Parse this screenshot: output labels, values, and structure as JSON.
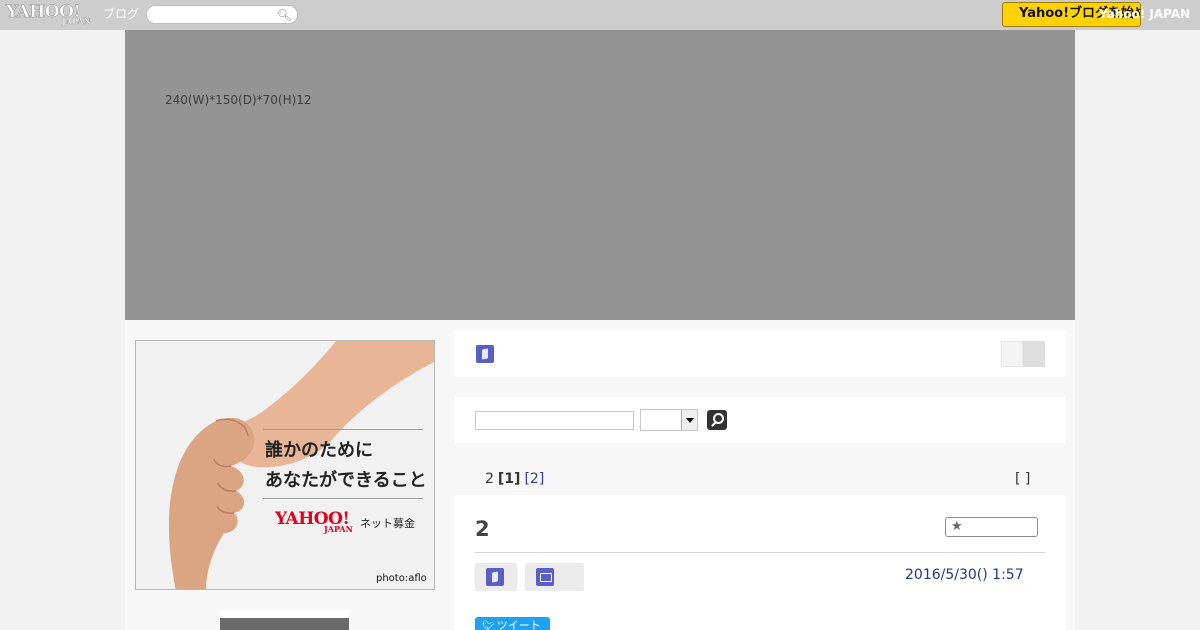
{
  "topbar": {
    "logo_text": "YAHOO!",
    "logo_sub": "JAPAN",
    "logo_blog": "ブログ",
    "search_placeholder": "",
    "search_icon": "magnifier",
    "yj_button_label": "Yahoo!ブログを始める",
    "yj_link": "Yahoo! JAPAN"
  },
  "header": {
    "description": "240(W)*150(D)*70(H)12"
  },
  "ad": {
    "line1": "誰かのために",
    "line2": "あなたができること",
    "brand": "YAHOO!",
    "brand_sub": "JAPAN",
    "service": "ネット募金",
    "credit": "photo:aflo"
  },
  "blog_search": {
    "input_value": "",
    "select_value": ""
  },
  "pager": {
    "count": "2",
    "current": "[1]",
    "next": "[2]",
    "bracket": "[ ]"
  },
  "article": {
    "title": "2",
    "date": "2016/5/30()  1:57",
    "tweet_label": "ツイート"
  },
  "colors": {
    "topbar": "#cdcdcd",
    "header": "#949494",
    "accent_icon": "#5a5fc6",
    "yahoo_button": "#ffd200",
    "link": "#2b3ea0",
    "tweet": "#1da1f2"
  },
  "icons": [
    "search-icon",
    "book-icon",
    "folder-icon",
    "star-icon",
    "twitter-bird-icon",
    "dropdown-arrow-icon"
  ]
}
